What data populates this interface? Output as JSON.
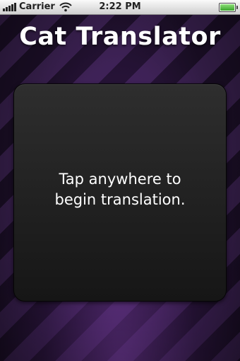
{
  "status_bar": {
    "carrier": "Carrier",
    "time": "2:22 PM",
    "signal_icon": "signal-bars-icon",
    "wifi_icon": "wifi-icon",
    "battery_icon": "battery-icon",
    "battery_level": 1.0,
    "battery_color": "#3aa52c"
  },
  "app": {
    "title": "Cat Translator"
  },
  "panel": {
    "prompt_line1": "Tap anywhere to",
    "prompt_line2": "begin translation."
  },
  "colors": {
    "background_stripe_light": "#3a2150",
    "background_stripe_dark": "#1c0f28",
    "panel": "#1e1e1e",
    "text": "#ffffff"
  }
}
